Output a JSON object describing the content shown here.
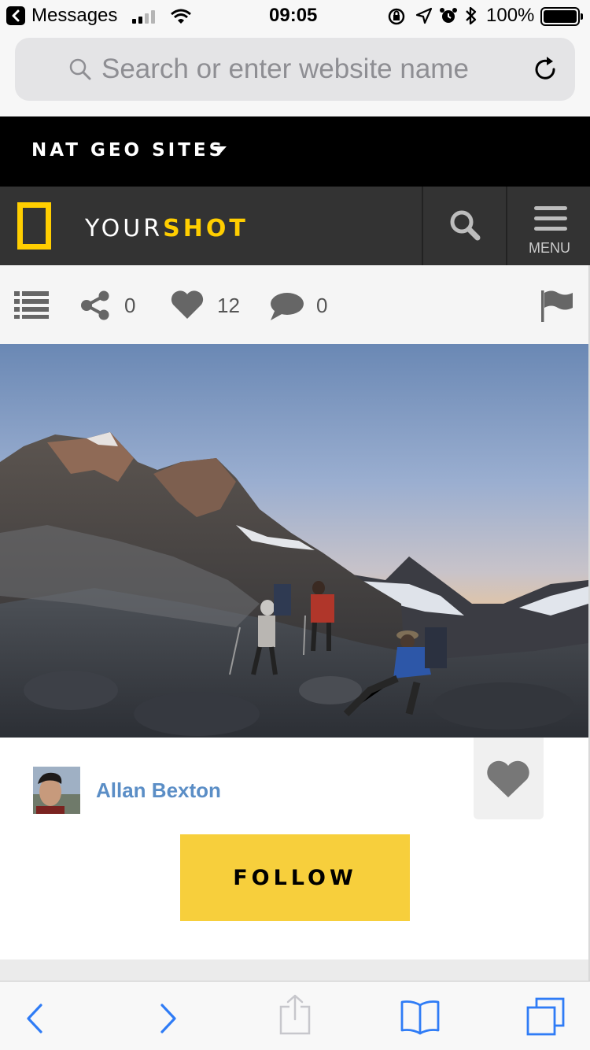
{
  "status_bar": {
    "back_app": "Messages",
    "time": "09:05",
    "battery": "100%"
  },
  "browser": {
    "search_placeholder": "Search or enter website name"
  },
  "natgeo_bar": {
    "label": "NAT GEO SITES"
  },
  "header": {
    "title_part1": "YOUR",
    "title_part2": "SHOT",
    "menu_label": "MENU"
  },
  "actions": {
    "share_count": "0",
    "like_count": "12",
    "comment_count": "0"
  },
  "user": {
    "name": "Allan Bexton",
    "follow_label": "FOLLOW"
  },
  "colors": {
    "brand_yellow": "#ffce00",
    "follow_yellow": "#f7cf3c",
    "link_blue": "#5b8ec6",
    "ios_blue": "#2f7cf6"
  },
  "icons": {
    "status": [
      "back-icon",
      "signal-icon",
      "wifi-icon",
      "orientation-lock-icon",
      "location-icon",
      "alarm-icon",
      "bluetooth-icon",
      "battery-icon"
    ],
    "toolbar": [
      "back-chevron-icon",
      "forward-chevron-icon",
      "share-icon",
      "bookmarks-icon",
      "tabs-icon"
    ]
  }
}
